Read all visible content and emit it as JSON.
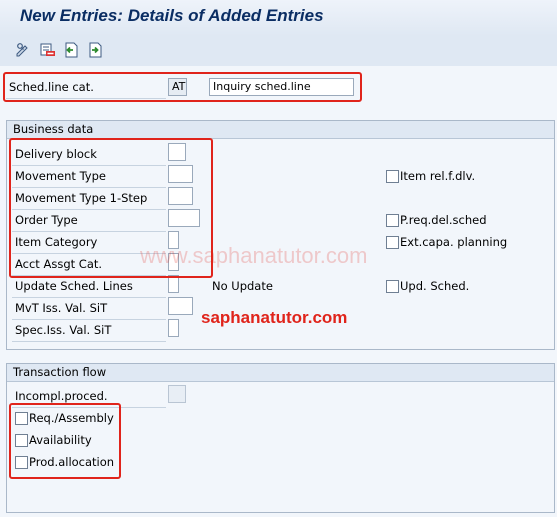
{
  "title": "New Entries: Details of Added Entries",
  "toolbar": {
    "icons": [
      "edit-display-icon",
      "delete-row-icon",
      "previous-entry-icon",
      "next-entry-icon"
    ]
  },
  "header": {
    "sched_line_label": "Sched.line cat.",
    "sched_line_value": "AT",
    "sched_line_desc": "Inquiry sched.line"
  },
  "business": {
    "title": "Business data",
    "delivery_block": "Delivery block",
    "movement_type": "Movement Type",
    "movement_type_1step": "Movement Type 1-Step",
    "order_type": "Order Type",
    "item_category": "Item Category",
    "acct_assgt_cat": "Acct Assgt Cat.",
    "upd_sched_lines": "Update Sched. Lines",
    "no_update": "No Update",
    "mvt_iss_val": "MvT Iss. Val. SiT",
    "spec_iss_val": "Spec.Iss. Val. SiT",
    "item_rel_dlv": "Item rel.f.dlv.",
    "preq_del_sched": "P.req.del.sched",
    "ext_capa": "Ext.capa. planning",
    "upd_sched": "Upd. Sched."
  },
  "transaction": {
    "title": "Transaction flow",
    "incompl_proced": "Incompl.proced.",
    "req_assembly": "Req./Assembly",
    "availability": "Availability",
    "prod_allocation": "Prod.allocation"
  },
  "watermark": {
    "faint": "www.saphanatutor.com",
    "main": "saphanatutor.com"
  },
  "colors": {
    "highlight_box": "#e0241b",
    "watermark_main": "#e0241b",
    "title": "#0a2d63"
  }
}
